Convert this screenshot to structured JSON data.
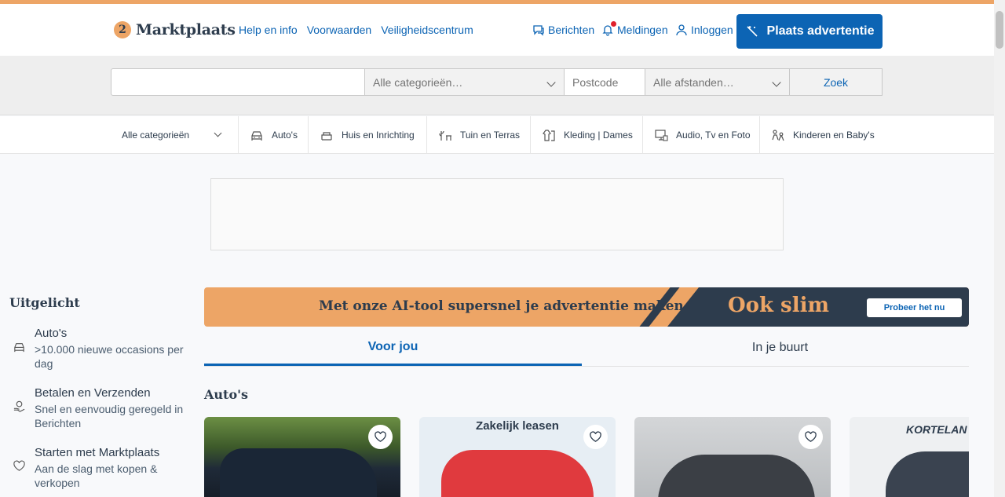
{
  "header": {
    "logo_text": "Marktplaats",
    "nav": [
      "Help en info",
      "Voorwaarden",
      "Veiligheidscentrum"
    ],
    "messages_label": "Berichten",
    "notifications_label": "Meldingen",
    "login_label": "Inloggen",
    "place_ad_label": "Plaats advertentie"
  },
  "search": {
    "query_value": "",
    "category_label": "Alle categorieën…",
    "postcode_placeholder": "Postcode",
    "distance_label": "Alle afstanden…",
    "submit_label": "Zoek"
  },
  "categories": {
    "all_label": "Alle categorieën",
    "items": [
      {
        "label": "Auto's",
        "icon": "car-icon"
      },
      {
        "label": "Huis en Inrichting",
        "icon": "furniture-icon"
      },
      {
        "label": "Tuin en Terras",
        "icon": "garden-icon"
      },
      {
        "label": "Kleding | Dames",
        "icon": "clothing-icon"
      },
      {
        "label": "Audio, Tv en Foto",
        "icon": "tv-icon"
      },
      {
        "label": "Kinderen en Baby's",
        "icon": "baby-icon"
      }
    ]
  },
  "sidebar": {
    "title": "Uitgelicht",
    "items": [
      {
        "title": "Auto's",
        "subtitle": ">10.000 nieuwe occasions per dag",
        "icon": "car-icon"
      },
      {
        "title": "Betalen en Verzenden",
        "subtitle": "Snel en eenvoudig geregeld in Berichten",
        "icon": "payment-icon"
      },
      {
        "title": "Starten met Marktplaats",
        "subtitle": "Aan de slag met kopen & verkopen",
        "icon": "heart-icon"
      }
    ]
  },
  "banner": {
    "text": "Met onze AI-tool supersnel je advertentie maken",
    "slogan": "Ook slim",
    "button_label": "Probeer het nu"
  },
  "tabs": [
    {
      "label": "Voor jou",
      "active": true
    },
    {
      "label": "In je buurt",
      "active": false
    }
  ],
  "section_title": "Auto's",
  "cards": [
    {
      "caption": "",
      "color": "#5b7a3a"
    },
    {
      "caption": "Zakelijk leasen",
      "color": "#e9eff5"
    },
    {
      "caption": "",
      "color": "#c9cbce"
    },
    {
      "caption": "KORTELAN",
      "color": "#eef0f2"
    }
  ],
  "colors": {
    "brand_orange": "#eda566",
    "brand_blue": "#0c64b4",
    "brand_navy": "#2d3c4d",
    "notification_red": "#e0212c"
  }
}
